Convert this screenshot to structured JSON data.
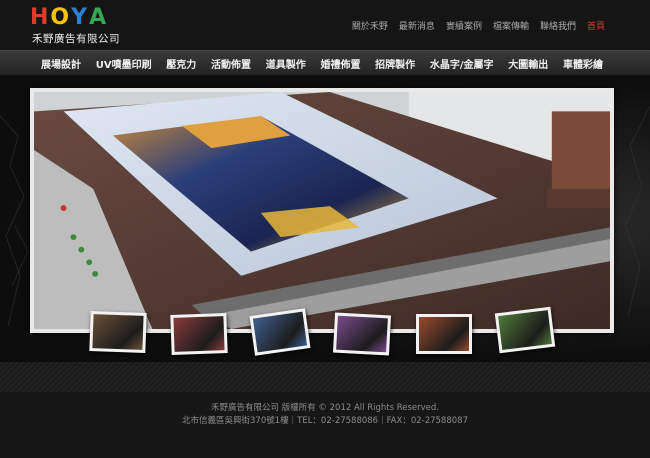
{
  "logo": {
    "letters": [
      {
        "char": "H",
        "color": "#e23a2a"
      },
      {
        "char": "O",
        "color": "#f2c300"
      },
      {
        "char": "Y",
        "color": "#2e7fd0"
      },
      {
        "char": "A",
        "color": "#34a853"
      }
    ],
    "company": "禾野廣告有限公司"
  },
  "top_links": [
    {
      "label": "關於禾野",
      "current": false
    },
    {
      "label": "最新消息",
      "current": false
    },
    {
      "label": "實績案例",
      "current": false
    },
    {
      "label": "檔案傳輸",
      "current": false
    },
    {
      "label": "聯絡我們",
      "current": false
    },
    {
      "label": "首頁",
      "current": true
    }
  ],
  "nav": [
    "展場設計",
    "UV噴墨印刷",
    "壓克力",
    "活動佈置",
    "道具製作",
    "婚禮佈置",
    "招牌製作",
    "水晶字/金屬字",
    "大圖輸出",
    "車體彩繪"
  ],
  "banner": {
    "thumbnails": [
      {
        "icon": "exhibit-thumb",
        "tone": "#6b5136"
      },
      {
        "icon": "event-thumb",
        "tone": "#8a3b3b"
      },
      {
        "icon": "printer-thumb",
        "tone": "#3f5f8e"
      },
      {
        "icon": "wedding-thumb",
        "tone": "#7a4b8d"
      },
      {
        "icon": "signage-thumb",
        "tone": "#9a4b2c"
      },
      {
        "icon": "vehicle-thumb",
        "tone": "#4f7a3a"
      }
    ]
  },
  "footer": {
    "line1": "禾野廣告有限公司 版權所有 © 2012 All Rights Reserved.",
    "line2": "北市信義區吳興街370號1樓｜TEL：02-27588086｜FAX：02-27588087"
  },
  "colors": {
    "accent": "#e23a2a",
    "background": "#1a1a1a"
  }
}
